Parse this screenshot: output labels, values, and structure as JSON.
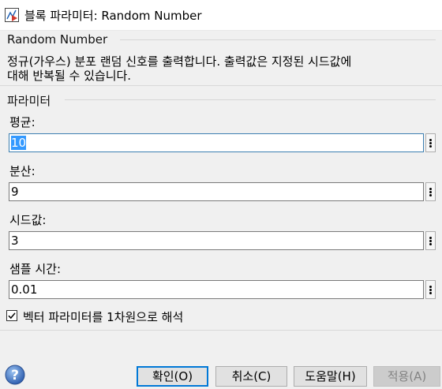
{
  "window": {
    "title": "블록 파라미터: Random Number"
  },
  "block": {
    "name": "Random Number",
    "description_lines": [
      "정규(가우스) 분포 랜덤 신호를 출력합니다. 출력값은 지정된 시드값에",
      "대해 반복될 수 있습니다."
    ]
  },
  "parameters": {
    "section_title": "파라미터",
    "fields": [
      {
        "label": "평균:",
        "value": "10"
      },
      {
        "label": "분산:",
        "value": "9"
      },
      {
        "label": "시드값:",
        "value": "3"
      },
      {
        "label": "샘플 시간:",
        "value": "0.01"
      }
    ],
    "vector_checkbox": {
      "label": "벡터 파라미터를 1차원으로 해석",
      "checked": true
    }
  },
  "buttons": {
    "ok": "확인(O)",
    "cancel": "취소(C)",
    "help": "도움말(H)",
    "apply": "적용(A)"
  },
  "icons": {
    "app": "simulink-block-icon",
    "help": "help-question-icon",
    "field_menu": "vertical-ellipsis-icon",
    "check": "checkmark-icon"
  }
}
